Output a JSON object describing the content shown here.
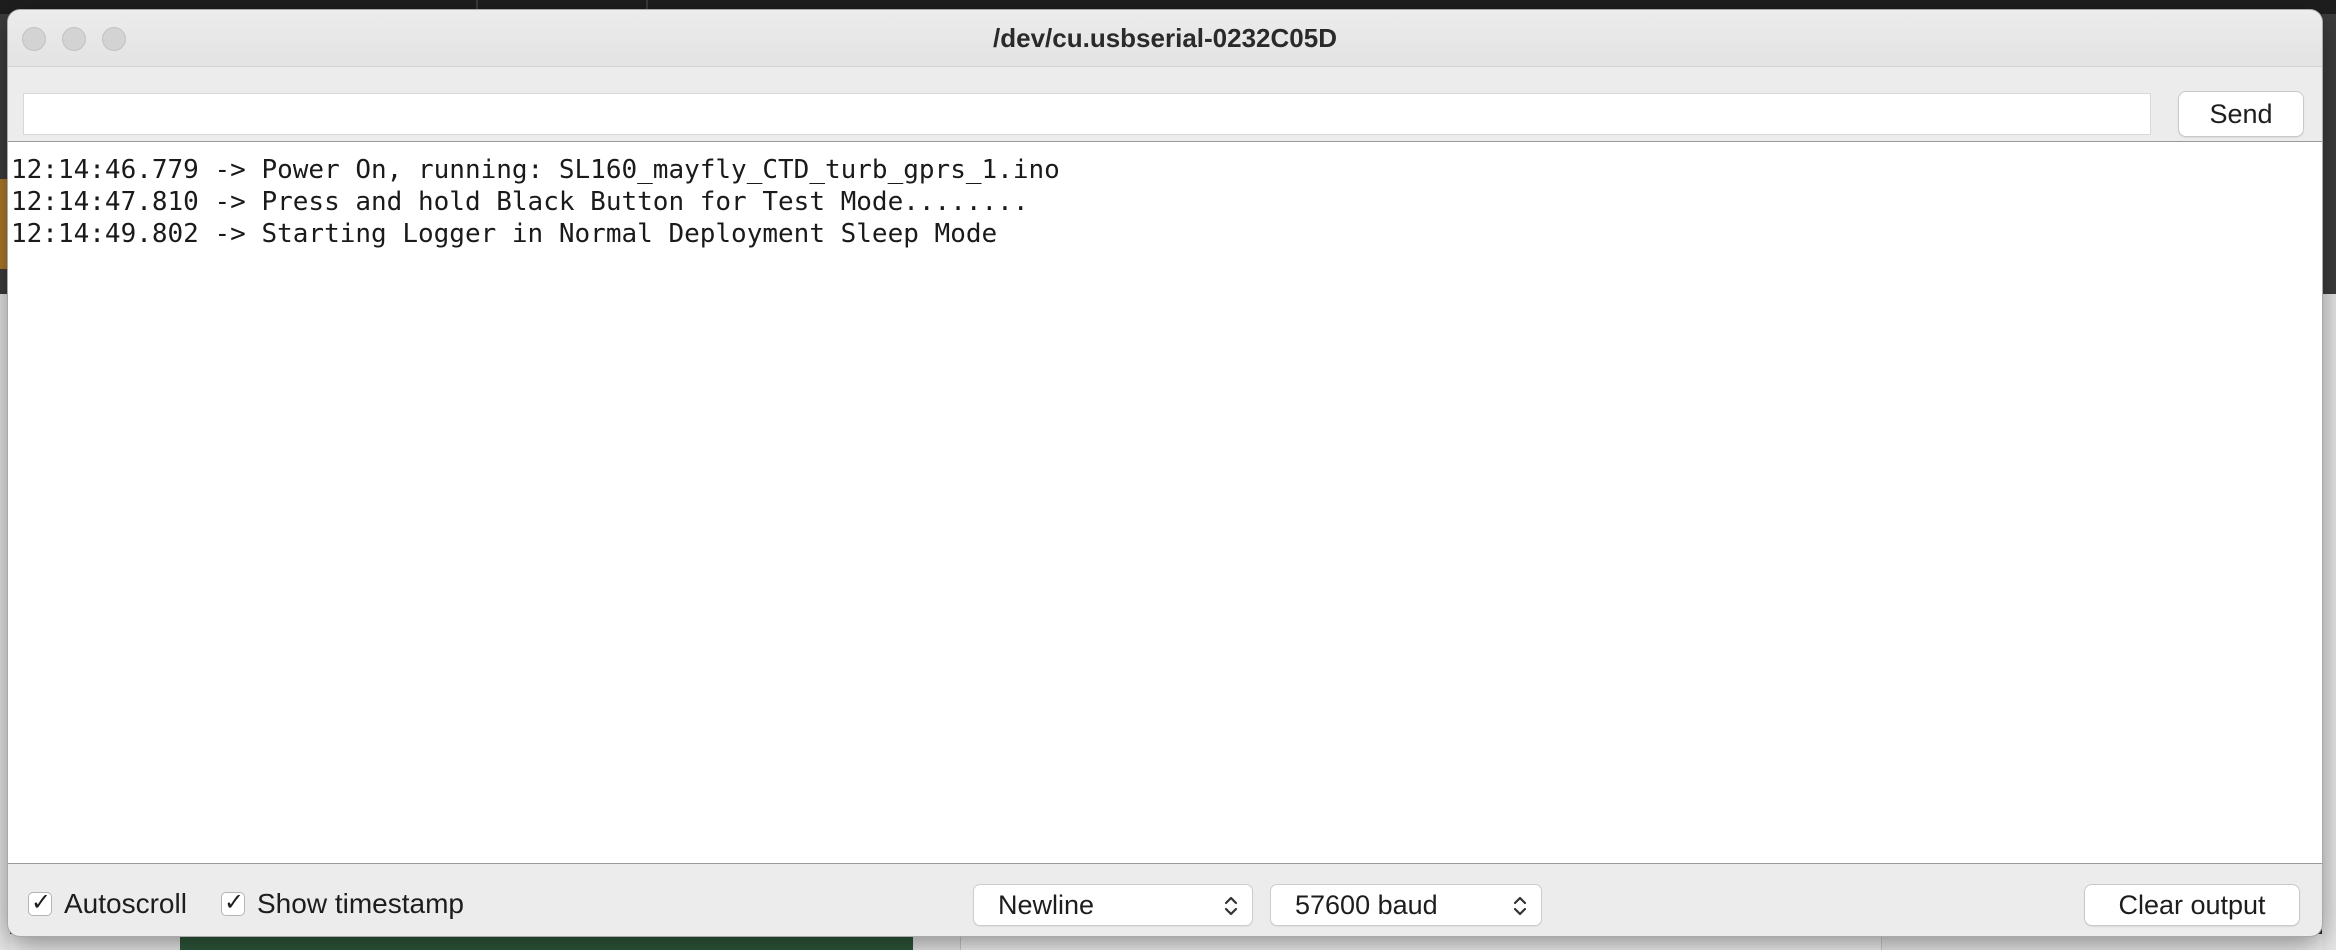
{
  "window": {
    "title": "/dev/cu.usbserial-0232C05D"
  },
  "send_bar": {
    "input_value": "",
    "send_label": "Send"
  },
  "output": {
    "lines": [
      "12:14:46.779 -> Power On, running: SL160_mayfly_CTD_turb_gprs_1.ino",
      "12:14:47.810 -> Press and hold Black Button for Test Mode........",
      "12:14:49.802 -> Starting Logger in Normal Deployment Sleep Mode"
    ]
  },
  "bottom_bar": {
    "autoscroll": {
      "label": "Autoscroll",
      "checked": true
    },
    "show_timestamp": {
      "label": "Show timestamp",
      "checked": true
    },
    "line_ending": {
      "selected": "Newline"
    },
    "baud_rate": {
      "selected": "57600 baud"
    },
    "clear_label": "Clear output"
  },
  "icons": {
    "checkmark": "checkmark-icon",
    "chevron": "chevron-up-down-icon"
  }
}
